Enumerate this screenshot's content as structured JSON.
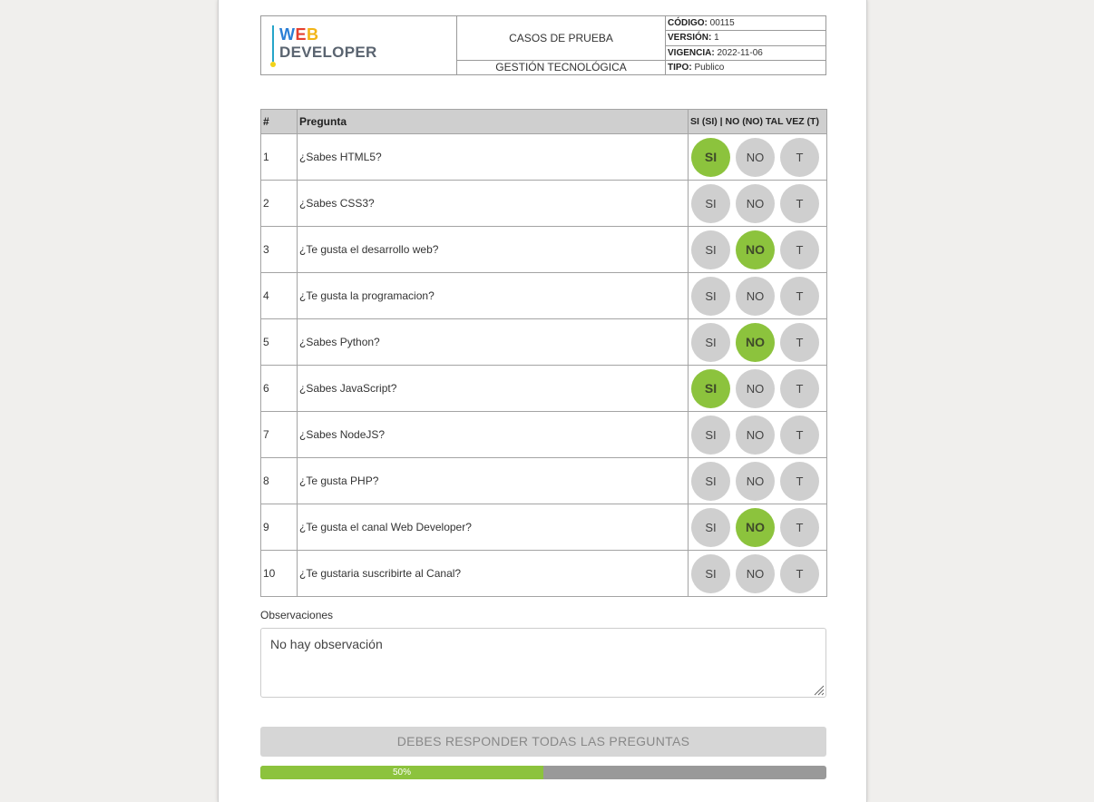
{
  "header": {
    "logo_line1": [
      "W",
      "E",
      "B"
    ],
    "logo_line1_colors": [
      "#2b7fd6",
      "#e5402f",
      "#f2b416"
    ],
    "logo_line2": "DEVELOPER",
    "title": "CASOS DE PRUEBA",
    "subtitle": "GESTIÓN TECNOLÓGICA",
    "meta": [
      {
        "label": "CÓDIGO:",
        "value": "00115"
      },
      {
        "label": "VERSIÓN:",
        "value": "1"
      },
      {
        "label": "VIGENCIA:",
        "value": "2022-11-06"
      },
      {
        "label": "TIPO:",
        "value": "Publico"
      }
    ]
  },
  "table": {
    "col_num": "#",
    "col_question": "Pregunta",
    "col_options": "SI (SI) | NO (NO) TAL VEZ (T)",
    "option_labels": [
      "SI",
      "NO",
      "T"
    ],
    "rows": [
      {
        "num": "1",
        "question": "¿Sabes HTML5?",
        "selected": "SI"
      },
      {
        "num": "2",
        "question": "¿Sabes CSS3?",
        "selected": ""
      },
      {
        "num": "3",
        "question": "¿Te gusta el desarrollo web?",
        "selected": "NO"
      },
      {
        "num": "4",
        "question": "¿Te gusta la programacion?",
        "selected": ""
      },
      {
        "num": "5",
        "question": "¿Sabes Python?",
        "selected": "NO"
      },
      {
        "num": "6",
        "question": "¿Sabes JavaScript?",
        "selected": "SI"
      },
      {
        "num": "7",
        "question": "¿Sabes NodeJS?",
        "selected": ""
      },
      {
        "num": "8",
        "question": "¿Te gusta PHP?",
        "selected": ""
      },
      {
        "num": "9",
        "question": "¿Te gusta el canal Web Developer?",
        "selected": "NO"
      },
      {
        "num": "10",
        "question": "¿Te gustaria suscribirte al Canal?",
        "selected": ""
      }
    ]
  },
  "observations": {
    "label": "Observaciones",
    "value": "No hay observación"
  },
  "submit_label": "DEBES RESPONDER TODAS LAS PREGUNTAS",
  "progress": {
    "label": "50%",
    "fraction": 0.5
  },
  "colors": {
    "selected": "#8cc33d",
    "unselected": "#cfcfcf",
    "progress_track": "#999999"
  }
}
